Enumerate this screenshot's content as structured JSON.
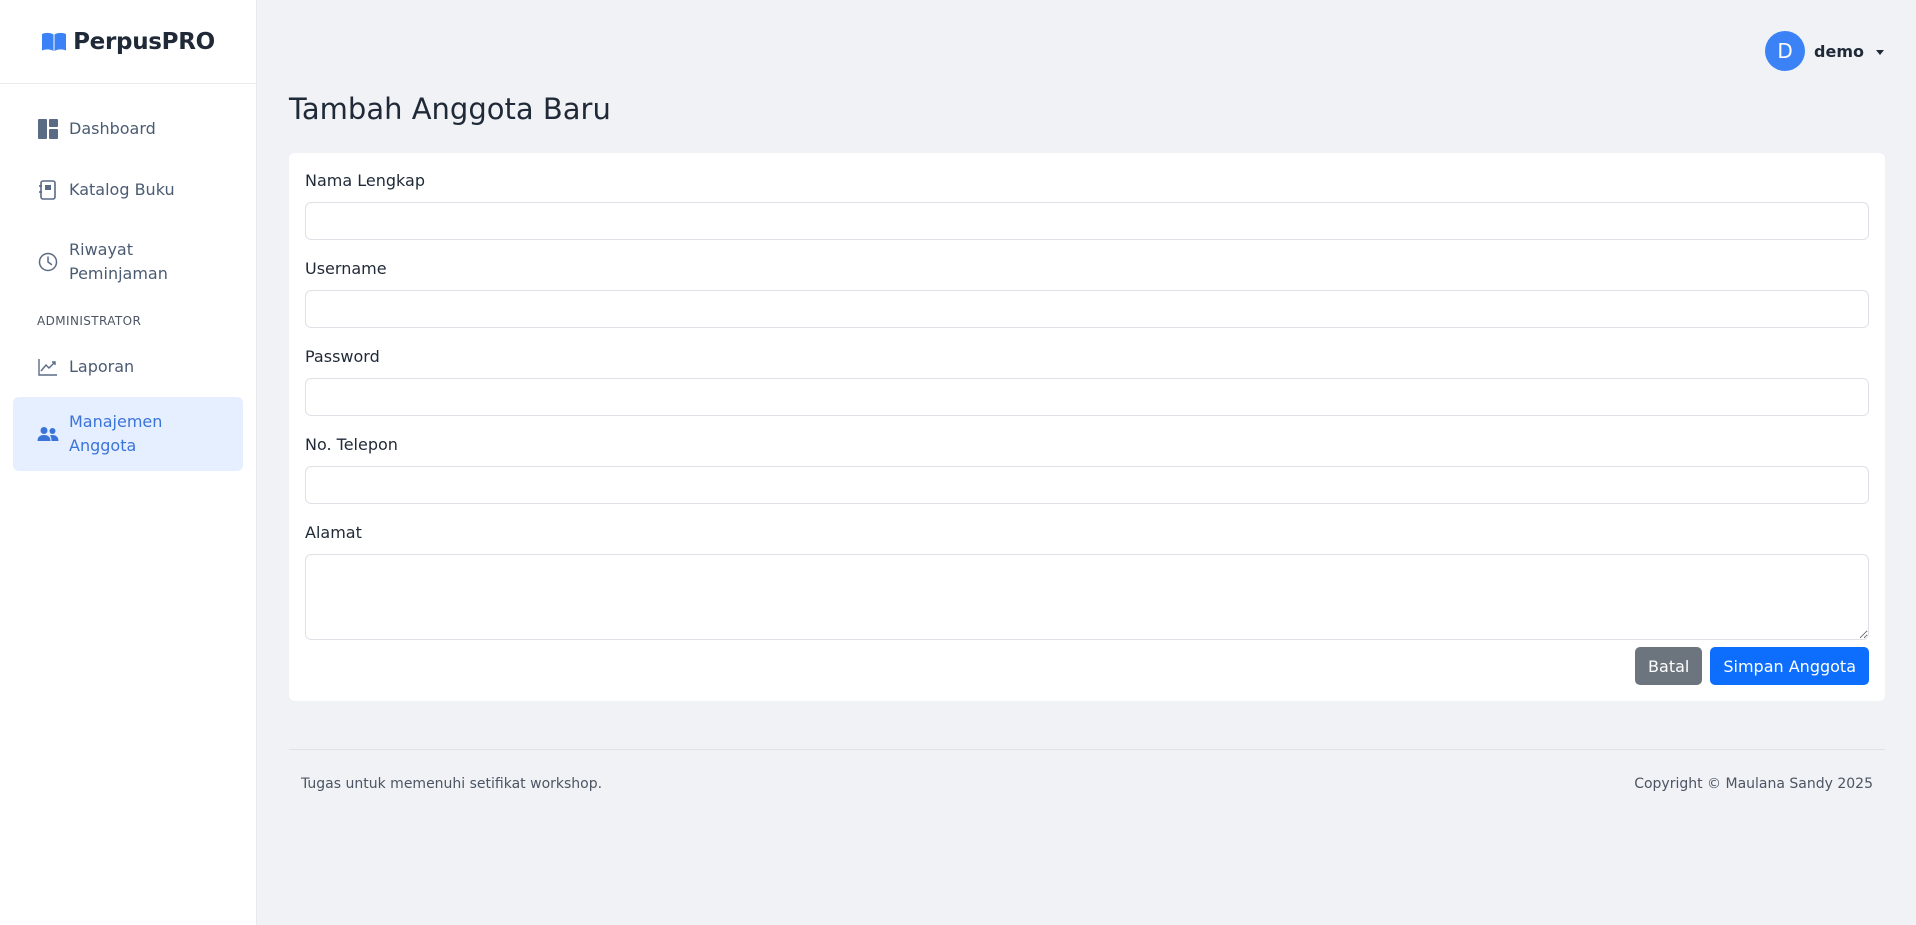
{
  "brand": {
    "name": "PerpusPRO",
    "logo_icon": "book-open-icon",
    "accent": "#3b82f6"
  },
  "sidebar": {
    "items": [
      {
        "label": "Dashboard",
        "icon": "dashboard-icon"
      },
      {
        "label": "Katalog Buku",
        "icon": "book-icon"
      },
      {
        "label": "Riwayat Peminjaman",
        "icon": "clock-icon"
      }
    ],
    "section_title": "ADMINISTRATOR",
    "admin_items": [
      {
        "label": "Laporan",
        "icon": "chart-line-icon"
      },
      {
        "label": "Manajemen Anggota",
        "icon": "users-icon",
        "active": true
      }
    ]
  },
  "user": {
    "initial": "D",
    "name": "demo"
  },
  "page": {
    "title": "Tambah Anggota Baru"
  },
  "form": {
    "fields": [
      {
        "label": "Nama Lengkap",
        "value": ""
      },
      {
        "label": "Username",
        "value": ""
      },
      {
        "label": "Password",
        "value": ""
      },
      {
        "label": "No. Telepon",
        "value": ""
      },
      {
        "label": "Alamat",
        "value": ""
      }
    ],
    "cancel_label": "Batal",
    "submit_label": "Simpan Anggota"
  },
  "footer": {
    "left_text": "Tugas untuk memenuhi setifikat workshop.",
    "right_text": "Copyright © Maulana Sandy 2025"
  },
  "colors": {
    "primary": "#0d6efd",
    "secondary": "#6c757d",
    "active_bg": "#e6efff",
    "active_text": "#3b74d8"
  }
}
